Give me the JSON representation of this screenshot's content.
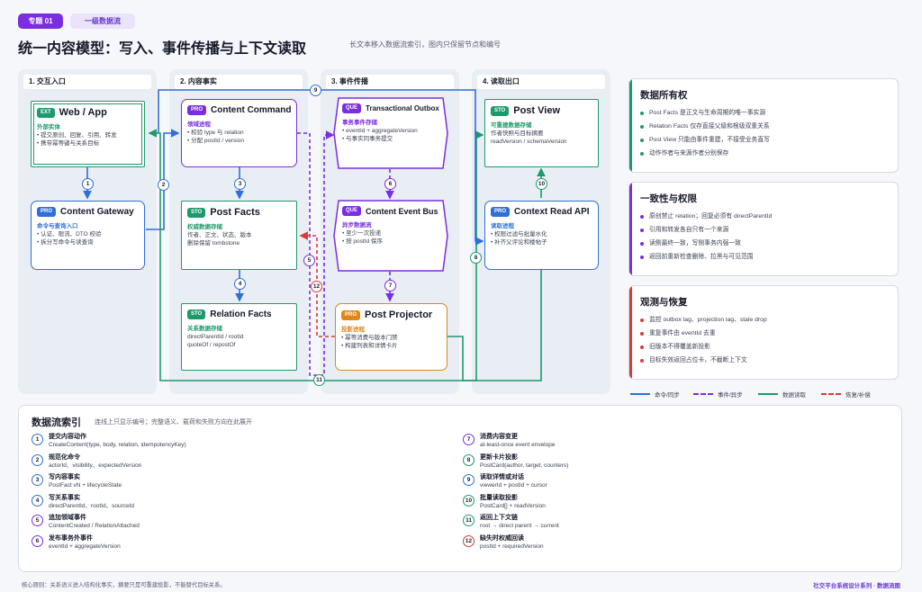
{
  "header": {
    "tag1": "专题 01",
    "tag2": "一级数据流",
    "title": "统一内容模型：写入、事件传播与上下文读取",
    "subtitle": "长文本移入数据流索引，图内只保留节点和编号"
  },
  "columns": [
    "1. 交互入口",
    "2. 内容事实",
    "3. 事件传播",
    "4. 读取出口"
  ],
  "nodes": {
    "web": {
      "badge": "EXT",
      "name": "Web / App",
      "sub": "外部实体",
      "lines": [
        "• 提交原创、回复、引用、转发",
        "• 携带幂等键与关系目标"
      ]
    },
    "gateway": {
      "badge": "PRO",
      "name": "Content Gateway",
      "sub": "命令与查询入口",
      "lines": [
        "• 认证、限流、DTO 校验",
        "• 拆分写命令与读查询"
      ]
    },
    "command": {
      "badge": "PRO",
      "name": "Content Command",
      "sub": "领域进程",
      "lines": [
        "• 校验 type 与 relation",
        "• 分配 postId / version"
      ]
    },
    "postfacts": {
      "badge": "STO",
      "name": "Post Facts",
      "sub": "权威数据存储",
      "lines": [
        "作者、正文、状态、版本",
        "删除保留 tombstone"
      ]
    },
    "relfacts": {
      "badge": "STO",
      "name": "Relation Facts",
      "sub": "关系数据存储",
      "lines": [
        "directParentId / rootId",
        "quoteOf / repostOf"
      ]
    },
    "outbox": {
      "badge": "QUE",
      "name": "Transactional Outbox",
      "sub": "事务事件存储",
      "lines": [
        "• eventId + aggregateVersion",
        "• 与事实同事务提交"
      ]
    },
    "eventbus": {
      "badge": "QUE",
      "name": "Content Event Bus",
      "sub": "异步数据流",
      "lines": [
        "• 至少一次投递",
        "• 按 postId 保序"
      ]
    },
    "projector": {
      "badge": "PRO",
      "name": "Post Projector",
      "sub": "投影进程",
      "lines": [
        "• 幂等消费与版本门禁",
        "• 构建列表和详情卡片"
      ]
    },
    "postview": {
      "badge": "STO",
      "name": "Post View",
      "sub": "可重建数据存储",
      "lines": [
        "作者快照与目标摘要",
        "readVersion / schemaVersion"
      ]
    },
    "context": {
      "badge": "PRO",
      "name": "Context Read API",
      "sub": "读取进程",
      "lines": [
        "• 权限过滤与批量水化",
        "• 补齐父评论和楼帖子"
      ]
    }
  },
  "flow_numbers": [
    "1",
    "2",
    "3",
    "4",
    "5",
    "6",
    "7",
    "8",
    "9",
    "10",
    "11",
    "12"
  ],
  "panels": [
    {
      "title": "数据所有权",
      "color": "#1d9a6c",
      "items": [
        "Post Facts 是正文与生命周期的唯一事实源",
        "Relation Facts 仅存直接父级和根级双重关系",
        "Post View 只能由事件重建，不接受业务直写",
        "动作作者与来源作者分别保存"
      ]
    },
    {
      "title": "一致性与权限",
      "color": "#7a2ee0",
      "items": [
        "原创禁止 relation；回复必须有 directParentId",
        "引用和转发各自只有一个来源",
        "读侧最终一致，写侧事务内强一致",
        "返回前重新检查删除、拉黑与可见范围"
      ]
    },
    {
      "title": "观测与恢复",
      "color": "#d63a3a",
      "items": [
        "监控 outbox lag、projection lag、stale drop",
        "重复事件由 eventId 去重",
        "旧版本不得覆盖新投影",
        "目标失效返回占位卡，不截断上下文"
      ]
    }
  ],
  "legend": [
    "命令/同步",
    "事件/异步",
    "数据读取",
    "恢复/补偿"
  ],
  "index": {
    "title": "数据流索引",
    "note": "连线上只显示编号；完整语义、载荷和失败方向在此展开",
    "items": [
      {
        "n": "1",
        "t": "提交内容动作",
        "d": "CreateContent(type, body, relation, idempotencyKey)",
        "c": "#2f6fd6"
      },
      {
        "n": "2",
        "t": "规范化命令",
        "d": "actorId、visibility、expectedVersion",
        "c": "#2f6fd6"
      },
      {
        "n": "3",
        "t": "写内容事实",
        "d": "PostFact vN + lifecycleState",
        "c": "#2f6fd6"
      },
      {
        "n": "4",
        "t": "写关系事实",
        "d": "directParentId、rootId、sourceId",
        "c": "#2f6fd6"
      },
      {
        "n": "5",
        "t": "追加领域事件",
        "d": "ContentCreated / RelationAttached",
        "c": "#7a2ee0"
      },
      {
        "n": "6",
        "t": "发布事务外事件",
        "d": "eventId + aggregateVersion",
        "c": "#7a2ee0"
      },
      {
        "n": "7",
        "t": "消费内容变更",
        "d": "at-least-once event envelope",
        "c": "#7a2ee0"
      },
      {
        "n": "8",
        "t": "更新卡片投影",
        "d": "PostCard(author, target, counters)",
        "c": "#1d9a6c"
      },
      {
        "n": "9",
        "t": "读取详情或对话",
        "d": "viewerId + postId + cursor",
        "c": "#2f6fd6"
      },
      {
        "n": "10",
        "t": "批量读取投影",
        "d": "PostCard[] + readVersion",
        "c": "#1d9a6c"
      },
      {
        "n": "11",
        "t": "返回上下文链",
        "d": "root → direct parent → current",
        "c": "#1d9a6c"
      },
      {
        "n": "12",
        "t": "缺失时权威回读",
        "d": "postId + requiredVersion",
        "c": "#d63a3a"
      }
    ]
  },
  "footer": {
    "left": "核心原则：关系语义进入结构化事实，摘要只是可重建投影，不能替代目标关系。",
    "right": "社交平台系统设计系列 · 数据流图"
  },
  "colors": {
    "blue": "#2f6fd6",
    "purple": "#7a2ee0",
    "green": "#1d9a6c",
    "orange": "#e0861b",
    "red": "#d63a3a"
  }
}
